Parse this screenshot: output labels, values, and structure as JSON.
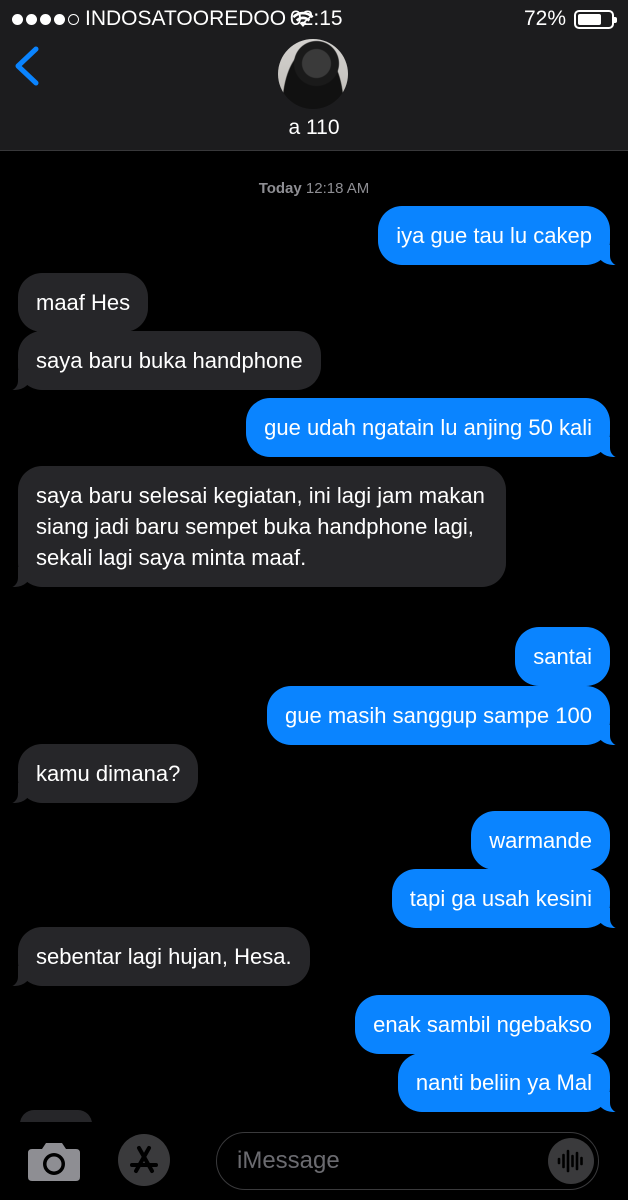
{
  "status_bar": {
    "carrier": "INDOSATOOREDOO",
    "time": "02:15",
    "battery": "72%",
    "battery_level": 0.72
  },
  "header": {
    "back_icon": "chevron-left-icon",
    "contact_name": "a 110"
  },
  "thread": {
    "timestamp_day": "Today",
    "timestamp_time": "12:18 AM",
    "messages": [
      {
        "from": "me",
        "text": "iya gue tau lu cakep"
      },
      {
        "from": "them",
        "text": "maaf Hes"
      },
      {
        "from": "them",
        "text": "saya baru buka handphone"
      },
      {
        "from": "me",
        "text": "gue udah ngatain lu anjing 50 kali"
      },
      {
        "from": "them",
        "text": "saya baru selesai kegiatan, ini lagi jam makan siang jadi baru sempet buka handphone lagi, sekali lagi saya minta maaf."
      },
      {
        "from": "me",
        "text": "santai"
      },
      {
        "from": "me",
        "text": "gue masih sanggup sampe 100"
      },
      {
        "from": "them",
        "text": "kamu dimana?"
      },
      {
        "from": "me",
        "text": "warmande"
      },
      {
        "from": "me",
        "text": "tapi ga usah kesini"
      },
      {
        "from": "them",
        "text": "sebentar lagi hujan, Hesa."
      },
      {
        "from": "me",
        "text": "enak sambil ngebakso"
      },
      {
        "from": "me",
        "text": "nanti beliin ya Mal"
      }
    ]
  },
  "composer": {
    "placeholder": "iMessage",
    "camera_icon": "camera-icon",
    "apps_icon": "app-store-icon",
    "audio_icon": "audio-waveform-icon"
  },
  "colors": {
    "outgoing_bubble": "#0a84ff",
    "incoming_bubble": "#262629",
    "accent": "#0a84ff"
  }
}
